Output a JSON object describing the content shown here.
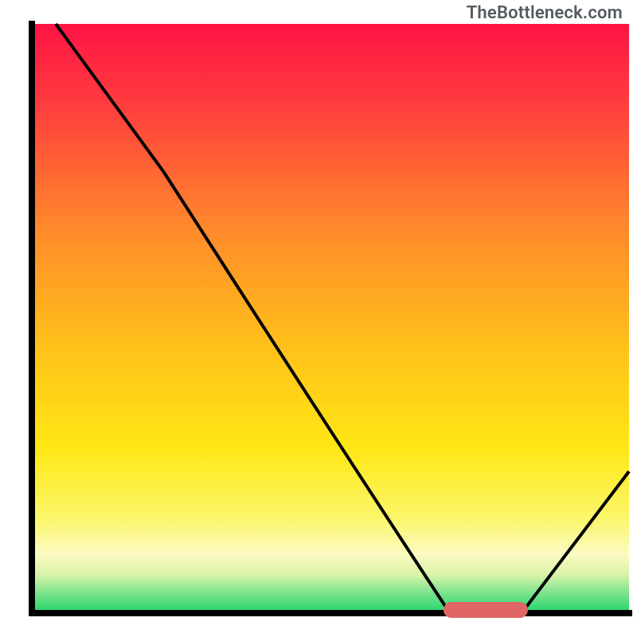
{
  "watermark": "TheBottleneck.com",
  "chart_data": {
    "type": "line",
    "title": "",
    "xlabel": "",
    "ylabel": "",
    "xlim": [
      0,
      100
    ],
    "ylim": [
      0,
      100
    ],
    "grid": false,
    "legend": false,
    "series": [
      {
        "name": "curve",
        "x": [
          4,
          22,
          70,
          82,
          100
        ],
        "y": [
          100,
          75,
          0,
          0,
          24
        ]
      }
    ],
    "marker": {
      "name": "highlight-segment",
      "x_start": 70,
      "x_end": 82,
      "y": 0,
      "color": "#e06666"
    },
    "background_gradient": [
      {
        "stop": 0.0,
        "color": "#ff1445"
      },
      {
        "stop": 0.14,
        "color": "#ff3e3e"
      },
      {
        "stop": 0.35,
        "color": "#ff8a2a"
      },
      {
        "stop": 0.55,
        "color": "#ffc21a"
      },
      {
        "stop": 0.72,
        "color": "#ffe714"
      },
      {
        "stop": 0.84,
        "color": "#fbf76b"
      },
      {
        "stop": 0.9,
        "color": "#fcfac2"
      },
      {
        "stop": 0.935,
        "color": "#d9f4a8"
      },
      {
        "stop": 0.965,
        "color": "#7de48e"
      },
      {
        "stop": 1.0,
        "color": "#1fd36a"
      }
    ],
    "colors": {
      "axis": "#000000",
      "line": "#000000",
      "marker": "#e06666"
    }
  }
}
